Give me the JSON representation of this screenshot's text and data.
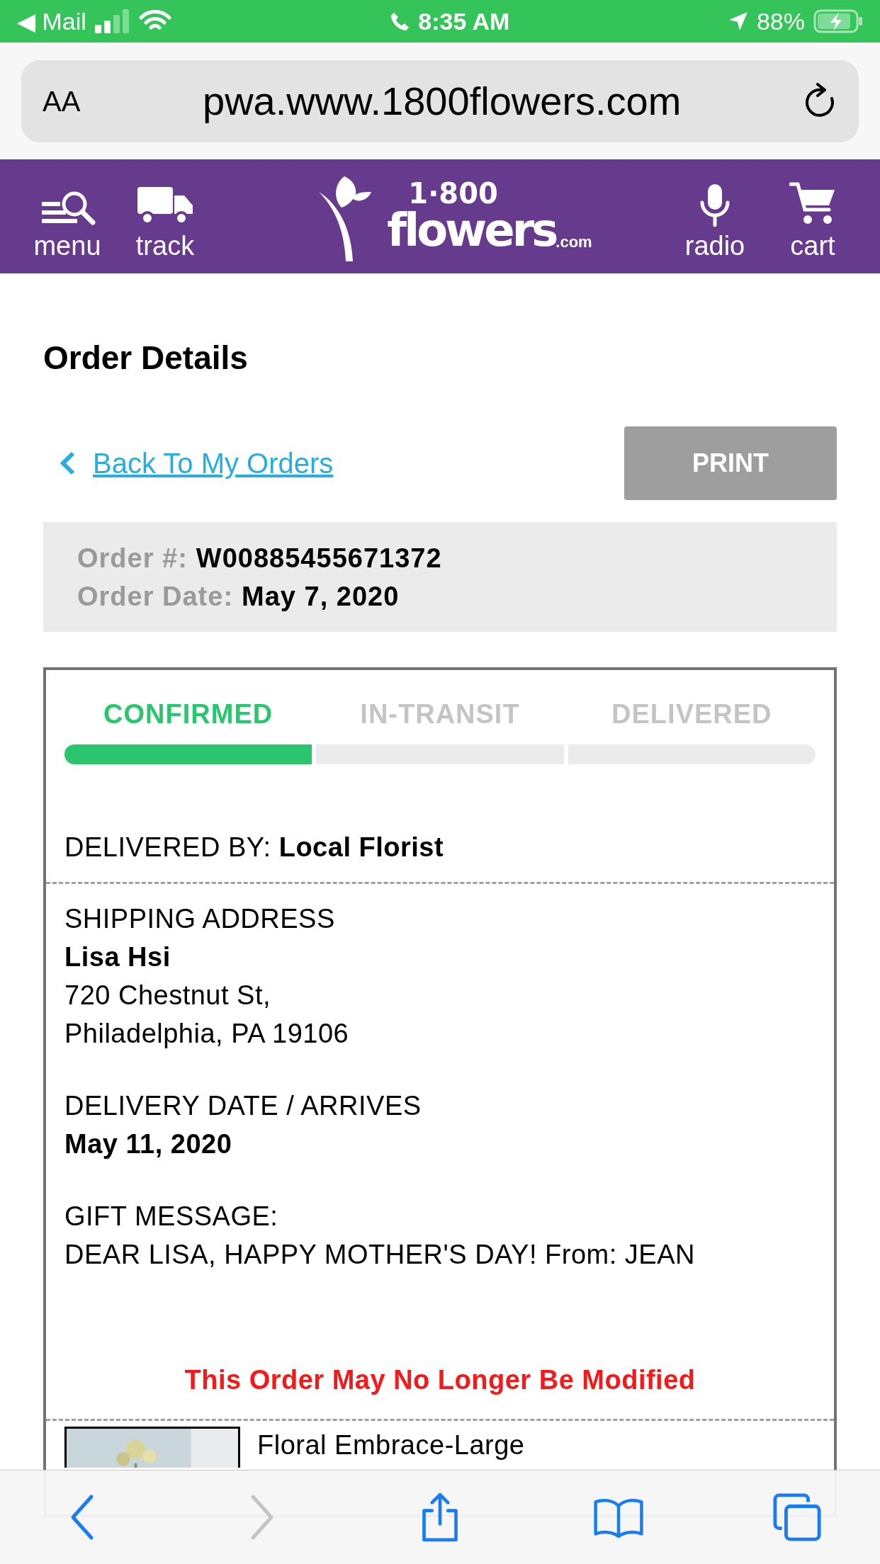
{
  "status_bar": {
    "back_app": "◀ Mail",
    "time": "8:35 AM",
    "battery": "88%"
  },
  "browser": {
    "text_size": "AA",
    "url": "pwa.www.1800flowers.com"
  },
  "header": {
    "left": [
      {
        "label": "menu",
        "kind": "menu"
      },
      {
        "label": "track",
        "kind": "track"
      }
    ],
    "logo": {
      "top": "1·800",
      "main": "flowers",
      "suffix": ".com"
    },
    "right": [
      {
        "label": "radio",
        "kind": "radio"
      },
      {
        "label": "cart",
        "kind": "cart"
      }
    ]
  },
  "page_title": "Order Details",
  "back_link": "Back To My Orders",
  "print_button": "PRINT",
  "order": {
    "number_label": "Order #:",
    "number": "W00885455671372",
    "date_label": "Order Date:",
    "date": "May 7, 2020"
  },
  "steps": [
    {
      "label": "CONFIRMED",
      "done": true
    },
    {
      "label": "IN-TRANSIT",
      "done": false
    },
    {
      "label": "DELIVERED",
      "done": false
    }
  ],
  "delivered_by": {
    "label": "DELIVERED BY:",
    "value": "Local Florist"
  },
  "shipping": {
    "label": "SHIPPING ADDRESS",
    "name": "Lisa Hsi",
    "lines": [
      "720 Chestnut St,",
      "Philadelphia, PA 19106"
    ]
  },
  "delivery_date": {
    "label": "DELIVERY DATE / ARRIVES",
    "value": "May 11, 2020"
  },
  "gift_message": {
    "label": "GIFT MESSAGE:",
    "text": "DEAR LISA, HAPPY MOTHER'S DAY! From: JEAN"
  },
  "notice": "This Order May No Longer Be Modified",
  "items": [
    {
      "name": "Floral Embrace-Large"
    }
  ],
  "toolbar": [
    {
      "kind": "back",
      "disabled": false
    },
    {
      "kind": "forward",
      "disabled": true
    },
    {
      "kind": "share",
      "disabled": false
    },
    {
      "kind": "bookmarks",
      "disabled": false
    },
    {
      "kind": "tabs",
      "disabled": false
    }
  ]
}
